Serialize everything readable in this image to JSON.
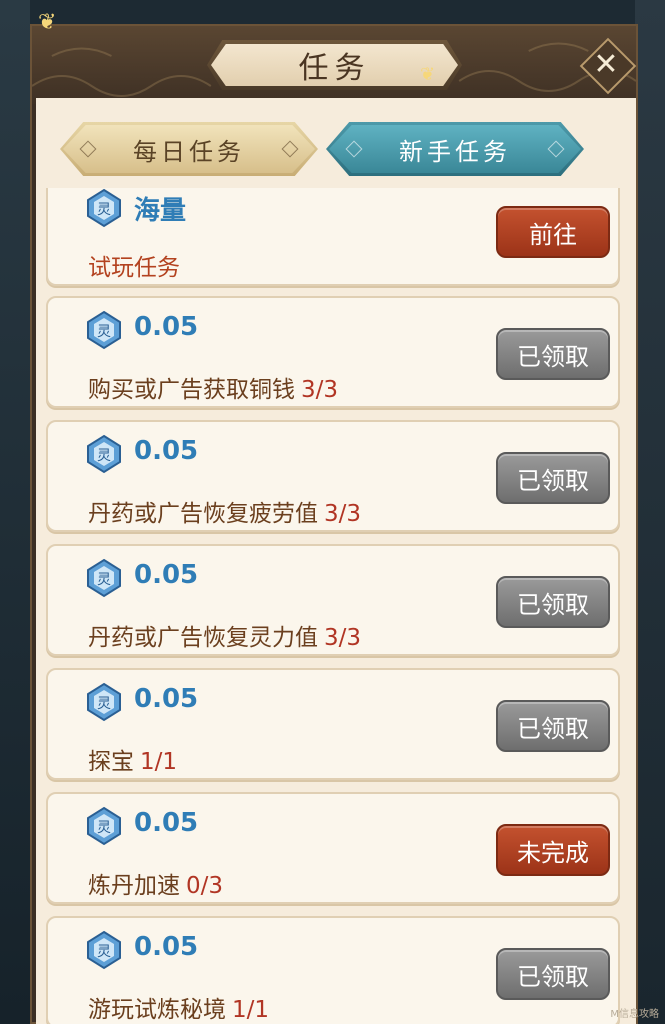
{
  "dialog": {
    "title": "任务",
    "close_icon": "close-icon"
  },
  "tabs": [
    {
      "label": "每日任务",
      "active": false
    },
    {
      "label": "新手任务",
      "active": true
    }
  ],
  "tasks": [
    {
      "reward": "海量",
      "name": "试玩任务",
      "progress": "",
      "button": "前往",
      "button_style": "red"
    },
    {
      "reward": "0.05",
      "name": "购买或广告获取铜钱",
      "progress": "3/3",
      "button": "已领取",
      "button_style": "gray"
    },
    {
      "reward": "0.05",
      "name": "丹药或广告恢复疲劳值",
      "progress": "3/3",
      "button": "已领取",
      "button_style": "gray"
    },
    {
      "reward": "0.05",
      "name": "丹药或广告恢复灵力值",
      "progress": "3/3",
      "button": "已领取",
      "button_style": "gray"
    },
    {
      "reward": "0.05",
      "name": "探宝",
      "progress": "1/1",
      "button": "已领取",
      "button_style": "gray"
    },
    {
      "reward": "0.05",
      "name": "炼丹加速",
      "progress": "0/3",
      "button": "未完成",
      "button_style": "red"
    },
    {
      "reward": "0.05",
      "name": "游玩试炼秘境",
      "progress": "1/1",
      "button": "已领取",
      "button_style": "gray"
    }
  ],
  "colors": {
    "reward_blue": "#2f7db6",
    "task_brown": "#6b3f1e",
    "progress_red": "#b13524",
    "button_red": "#b3421f",
    "button_gray": "#858585",
    "panel_cream": "#f6ecdc"
  },
  "watermark": "M信息攻略"
}
